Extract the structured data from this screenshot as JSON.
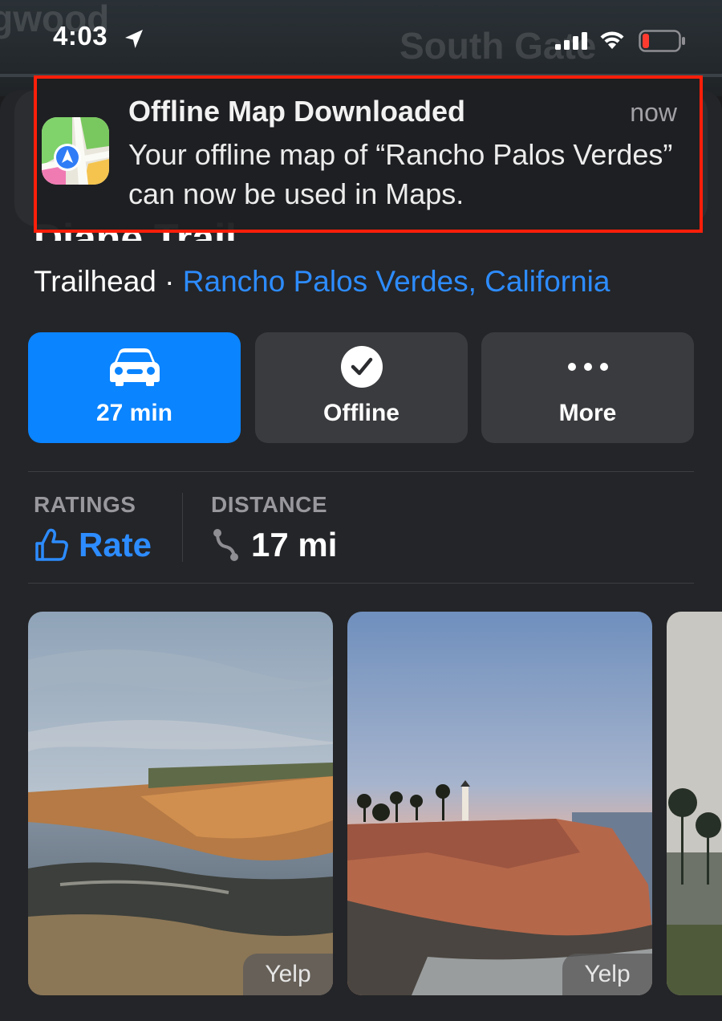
{
  "status_bar": {
    "time": "4:03"
  },
  "map": {
    "labels": [
      "South Gate"
    ]
  },
  "notification": {
    "title": "Offline Map Downloaded",
    "time": "now",
    "body": "Your offline map of “Rancho Palos Verdes” can now be used in Maps.",
    "app_icon": "maps-app-icon",
    "highlight_color": "#ff1f0a"
  },
  "place": {
    "title": "Diane Trail",
    "category": "Trailhead",
    "separator": " · ",
    "location": "Rancho Palos Verdes, California"
  },
  "actions": [
    {
      "label": "27 min",
      "icon": "car-icon"
    },
    {
      "label": "Offline",
      "icon": "checkmark-circle-icon"
    },
    {
      "label": "More",
      "icon": "ellipsis-icon"
    }
  ],
  "info": {
    "ratings_label": "RATINGS",
    "ratings_value": "Rate",
    "distance_label": "DISTANCE",
    "distance_value": "17 mi"
  },
  "photos": [
    {
      "source": "Yelp"
    },
    {
      "source": "Yelp"
    }
  ],
  "colors": {
    "accent": "#0a84ff",
    "link": "#2d8cff",
    "sheet": "#242528"
  }
}
